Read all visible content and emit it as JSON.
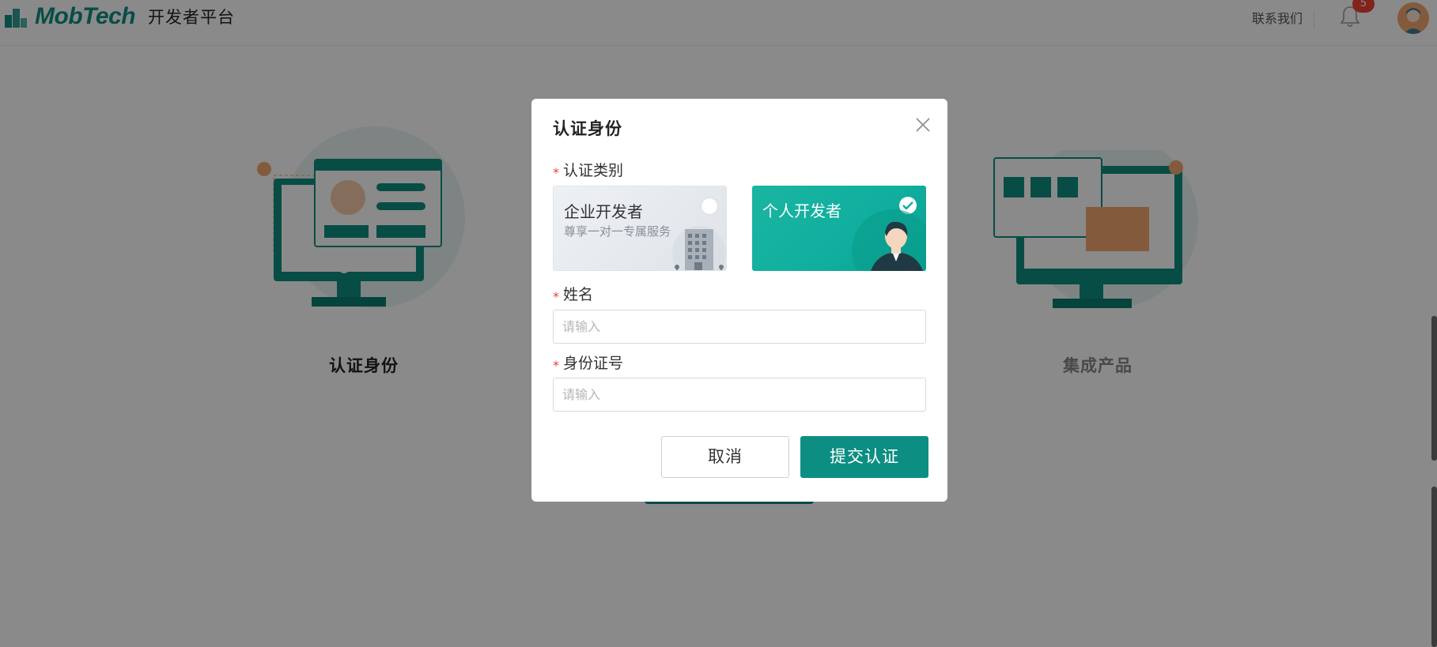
{
  "header": {
    "brand": "MobTech",
    "platform_name": "开发者平台",
    "contact_label": "联系我们",
    "notification_count": "5"
  },
  "steps": [
    {
      "title": "认证身份"
    },
    {
      "title": "集成产品"
    }
  ],
  "modal": {
    "title": "认证身份",
    "type_label": "认证类别",
    "options": [
      {
        "title": "企业开发者",
        "subtitle": "尊享一对一专属服务",
        "selected": false
      },
      {
        "title": "个人开发者",
        "subtitle": "",
        "selected": true
      }
    ],
    "name_label": "姓名",
    "name_placeholder": "请输入",
    "id_label": "身份证号",
    "id_placeholder": "请输入",
    "cancel_label": "取消",
    "submit_label": "提交认证"
  },
  "colors": {
    "brand": "#0d8e82",
    "required": "#f04134",
    "badge": "#f04134"
  }
}
